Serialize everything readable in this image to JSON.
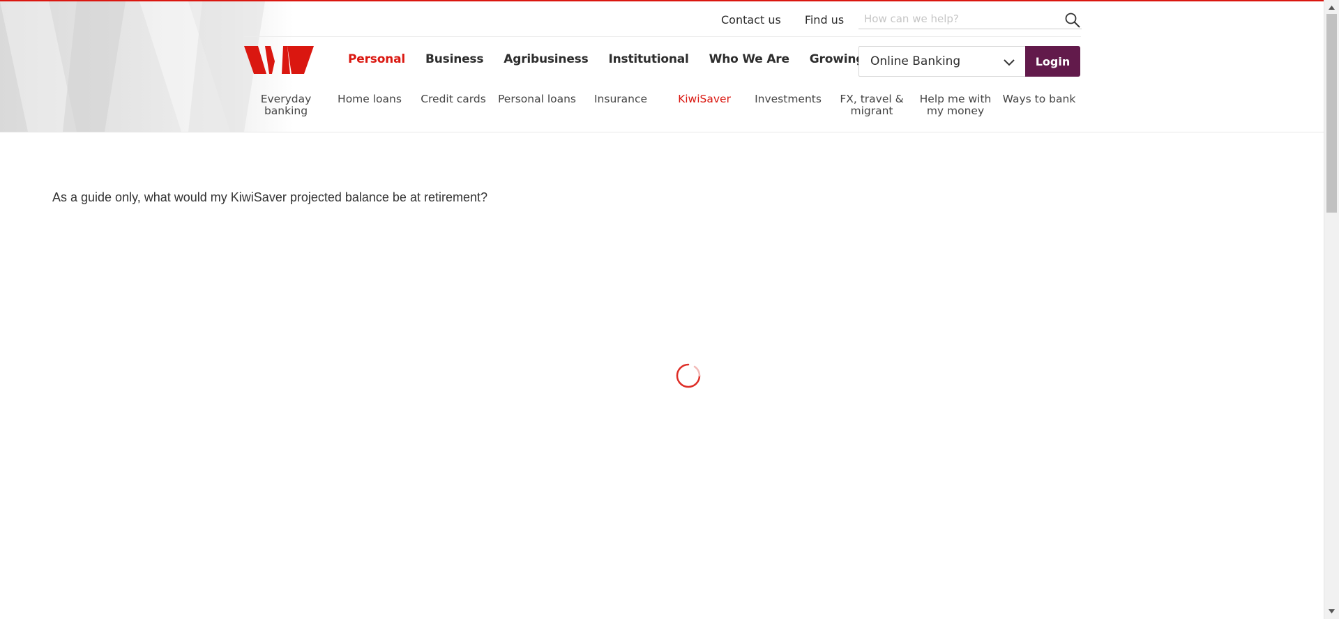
{
  "colors": {
    "brand_red": "#da1710",
    "login_purple": "#621a4b",
    "text_dark": "#2d2d2d"
  },
  "utility": {
    "links": [
      "Contact us",
      "Find us"
    ],
    "search_placeholder": "How can we help?",
    "search_icon": "search-icon"
  },
  "logo": {
    "icon": "westpac-logo"
  },
  "main_nav": {
    "items": [
      "Personal",
      "Business",
      "Agribusiness",
      "Institutional",
      "Who We Are",
      "Growing NZ"
    ],
    "active": "Personal"
  },
  "banking": {
    "selected": "Online Banking",
    "dropdown_icon": "chevron-down-icon",
    "login_label": "Login"
  },
  "sub_nav": {
    "items": [
      "Everyday banking",
      "Home loans",
      "Credit cards",
      "Personal loans",
      "Insurance",
      "KiwiSaver",
      "Investments",
      "FX, travel & migrant",
      "Help me with my money",
      "Ways to bank"
    ],
    "active": "KiwiSaver"
  },
  "main": {
    "question": "As a guide only, what would my KiwiSaver projected balance be at retirement?",
    "loading_icon": "loading-spinner-icon"
  }
}
